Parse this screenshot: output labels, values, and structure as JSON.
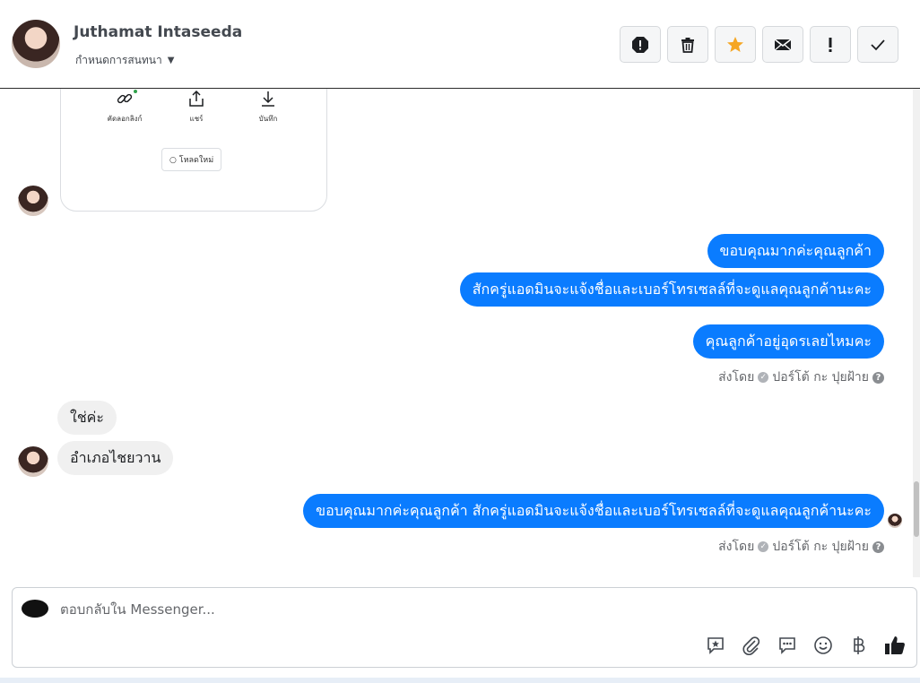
{
  "header": {
    "contact_name": "Juthamat Intaseeda",
    "assign_label": "กำหนดการสนทนา",
    "toolbar": [
      {
        "icon": "spam-icon",
        "name": "spam-button"
      },
      {
        "icon": "trash-icon",
        "name": "delete-button"
      },
      {
        "icon": "star-icon",
        "name": "star-button",
        "color": "#f5a623"
      },
      {
        "icon": "envelope-icon",
        "name": "mark-unread-button"
      },
      {
        "icon": "exclamation-icon",
        "name": "follow-up-button"
      },
      {
        "icon": "checkmark-icon",
        "name": "done-button"
      }
    ]
  },
  "card": {
    "actions": [
      {
        "label": "คัดลอกลิงก์",
        "icon": "link-icon"
      },
      {
        "label": "แชร์",
        "icon": "share-icon"
      },
      {
        "label": "บันทึก",
        "icon": "download-icon"
      }
    ],
    "reload_label": "โหลดใหม่"
  },
  "messages": {
    "out1": "ขอบคุณมากค่ะคุณลูกค้า",
    "out2": "สักครู่แอดมินจะแจ้งชื่อและเบอร์โทรเซลล์ที่จะดูแลคุณลูกค้านะคะ",
    "out3": "คุณลูกค้าอยู่อุดรเลยไหมคะ",
    "sent_by_1": {
      "prefix": "ส่งโดย",
      "author": "ปอร์โต้ กะ ปุยฝ้าย"
    },
    "in1": "ใช่ค่ะ",
    "in2": "อำเภอไชยวาน",
    "out4": "ขอบคุณมากค่ะคุณลูกค้า  สักครู่แอดมินจะแจ้งชื่อและเบอร์โทรเซลล์ที่จะดูแลคุณลูกค้านะคะ",
    "sent_by_2": {
      "prefix": "ส่งโดย",
      "author": "ปอร์โต้ กะ ปุยฝ้าย"
    }
  },
  "reply": {
    "placeholder": "ตอบกลับใน Messenger...",
    "tools": [
      "saved-reply-icon",
      "attachment-icon",
      "quick-reply-icon",
      "emoji-icon",
      "baht-icon",
      "thumbs-up-icon"
    ]
  },
  "colors": {
    "outgoing": "#0a7cff",
    "incoming": "#f0f0f0",
    "star": "#f5a623"
  }
}
